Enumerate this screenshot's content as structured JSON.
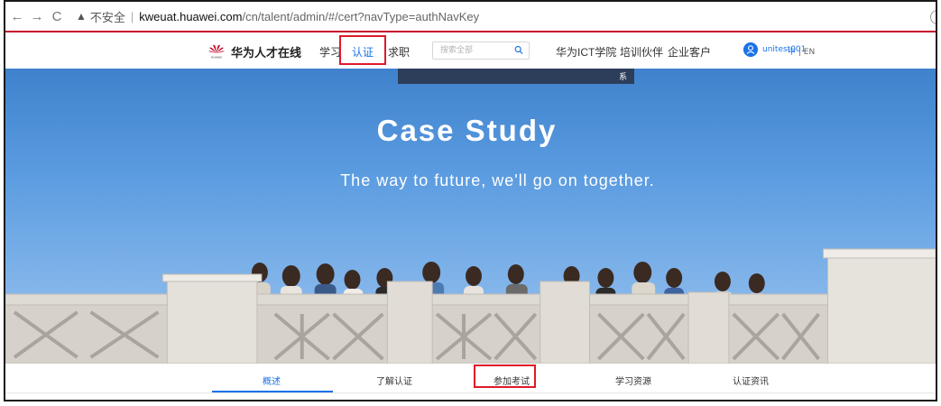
{
  "browser": {
    "security_warning": "不安全",
    "url_host": "kweuat.huawei.com",
    "url_path": "/cn/talent/admin/#/cert?navType=authNavKey"
  },
  "site": {
    "brand": "华为人才在线",
    "nav": [
      {
        "label": "学习"
      },
      {
        "label": "认证"
      },
      {
        "label": "求职"
      }
    ],
    "search_placeholder": "搜索全部",
    "right_nav": [
      {
        "label": "华为ICT学院"
      },
      {
        "label": "培训伙伴"
      },
      {
        "label": "企业客户"
      }
    ],
    "username": "unitest001",
    "lang_zh": "中",
    "lang_en": "EN",
    "logo_text": "HUAWEI",
    "brand_color": "#c8102e",
    "accent_color": "#1a73e8",
    "highlight_color": "#e0192a"
  },
  "hero": {
    "banner_snippet": "系",
    "title": "Case Study",
    "subtitle": "The way to future, we'll go on together."
  },
  "tabs": [
    {
      "label": "概述"
    },
    {
      "label": "了解认证"
    },
    {
      "label": "参加考试"
    },
    {
      "label": "学习资源"
    },
    {
      "label": "认证资讯"
    }
  ]
}
